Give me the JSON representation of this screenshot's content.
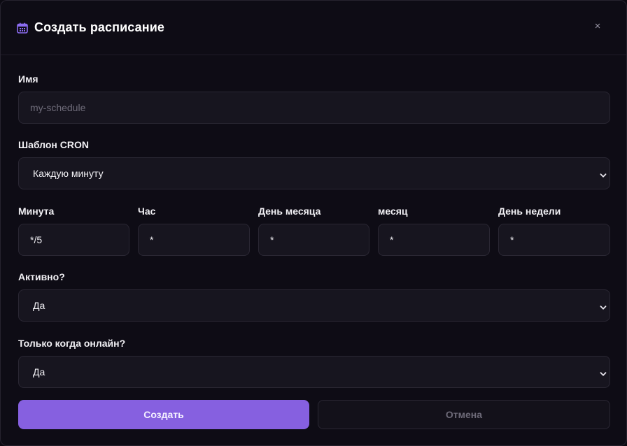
{
  "modal": {
    "title": "Создать расписание",
    "close_symbol": "×"
  },
  "form": {
    "name": {
      "label": "Имя",
      "placeholder": "my-schedule",
      "value": ""
    },
    "cron_template": {
      "label": "Шаблон CRON",
      "selected": "Каждую минуту"
    },
    "cron_fields": [
      {
        "label": "Минута",
        "value": "*/5"
      },
      {
        "label": "Час",
        "value": "*"
      },
      {
        "label": "День месяца",
        "value": "*"
      },
      {
        "label": "месяц",
        "value": "*"
      },
      {
        "label": "День недели",
        "value": "*"
      }
    ],
    "active": {
      "label": "Активно?",
      "selected": "Да"
    },
    "online_only": {
      "label": "Только когда онлайн?",
      "selected": "Да"
    }
  },
  "actions": {
    "create_label": "Создать",
    "cancel_label": "Отмена"
  },
  "colors": {
    "accent": "#8660e0",
    "background": "#0e0c15",
    "field_bg": "#17151f"
  },
  "icons": {
    "title_icon": "calendar-icon",
    "close_icon": "close-icon",
    "select_icon": "chevron-down-icon"
  }
}
